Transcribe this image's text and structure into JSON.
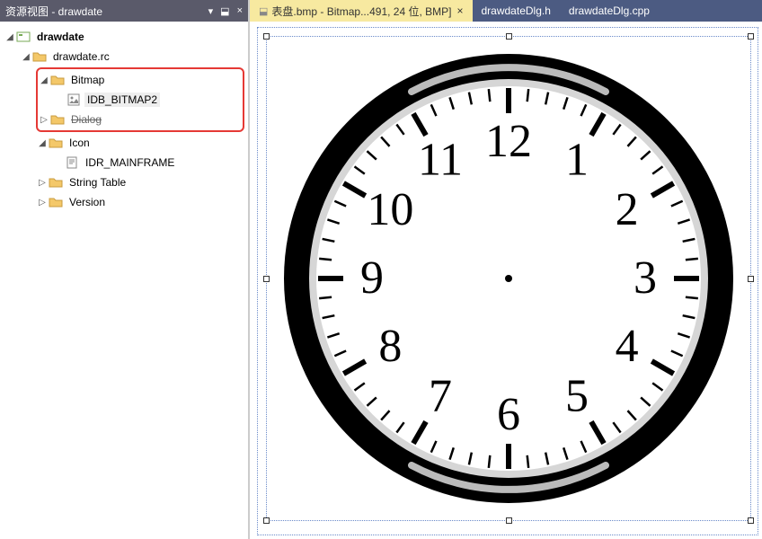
{
  "sidebar": {
    "title": "资源视图 - drawdate",
    "header_icons": {
      "dropdown": "▾",
      "pin": "⬓",
      "close": "×"
    },
    "root": {
      "label": "drawdate",
      "children": [
        {
          "label": "drawdate.rc",
          "children": [
            {
              "label": "Bitmap",
              "children": [
                {
                  "label": "IDB_BITMAP2",
                  "highlighted": true
                }
              ]
            },
            {
              "label": "Dialog",
              "strike": true
            },
            {
              "label": "Icon",
              "children": [
                {
                  "label": "IDR_MAINFRAME"
                }
              ]
            },
            {
              "label": "String Table",
              "collapsed": true
            },
            {
              "label": "Version",
              "collapsed": true
            }
          ]
        }
      ]
    }
  },
  "tabs": [
    {
      "label": "表盘.bmp - Bitmap...491, 24 位, BMP]",
      "active": true,
      "pinned": true
    },
    {
      "label": "drawdateDlg.h",
      "active": false
    },
    {
      "label": "drawdateDlg.cpp",
      "active": false
    }
  ],
  "clock": {
    "numerals": [
      "12",
      "1",
      "2",
      "3",
      "4",
      "5",
      "6",
      "7",
      "8",
      "9",
      "10",
      "11"
    ]
  }
}
